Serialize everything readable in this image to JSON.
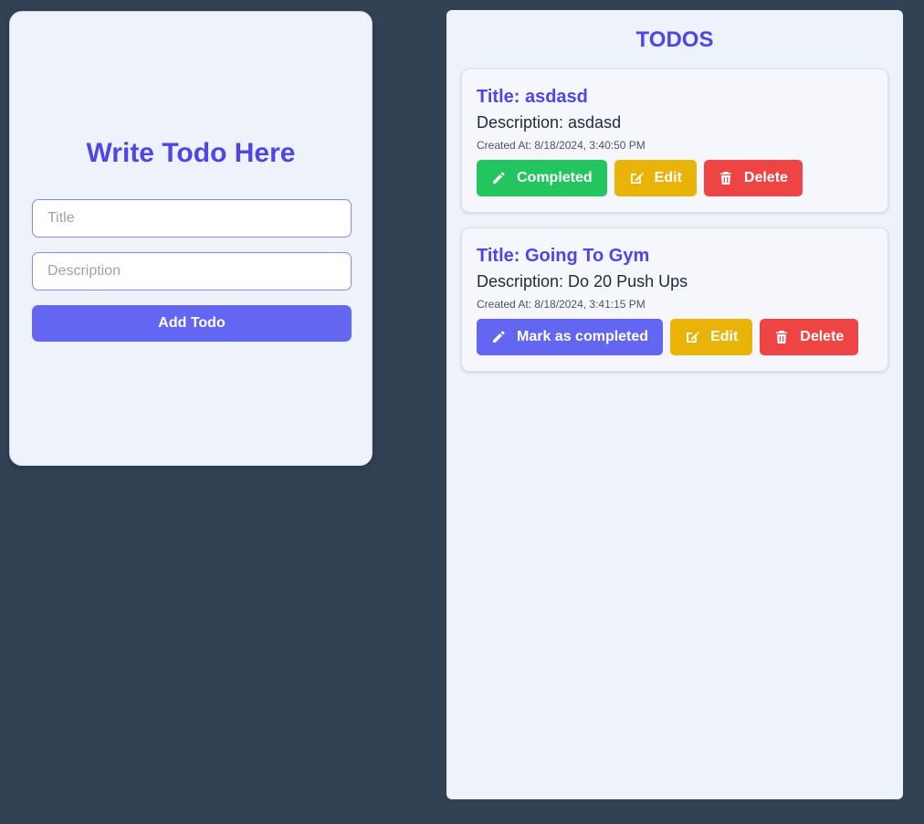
{
  "form": {
    "heading": "Write Todo Here",
    "title_placeholder": "Title",
    "description_placeholder": "Description",
    "submit_label": "Add Todo"
  },
  "todos_panel": {
    "heading": "TODOS",
    "todos": [
      {
        "title": "Title: asdasd",
        "description": "Description: asdasd",
        "created": "Created At: 8/18/2024, 3:40:50 PM",
        "status_button": "Completed",
        "status_icon": "pencil-icon",
        "status_color": "#22c55e",
        "edit_label": "Edit",
        "delete_label": "Delete"
      },
      {
        "title": "Title: Going To Gym",
        "description": "Description: Do 20 Push Ups",
        "created": "Created At: 8/18/2024, 3:41:15 PM",
        "status_button": "Mark as completed",
        "status_icon": "pencil-icon",
        "status_color": "#6366f1",
        "edit_label": "Edit",
        "delete_label": "Delete"
      }
    ]
  },
  "colors": {
    "background": "#334155",
    "accent": "#4f46e5",
    "primary_button": "#6366f1",
    "edit_button": "#eab308",
    "delete_button": "#ef4444",
    "completed_button": "#22c55e"
  }
}
